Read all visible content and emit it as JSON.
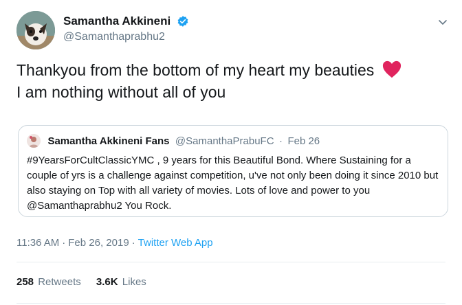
{
  "tweet": {
    "author": {
      "display_name": "Samantha Akkineni",
      "handle": "@Samanthaprabhu2",
      "verified": true,
      "avatar_icon": "dog-avatar-icon"
    },
    "menu_icon": "chevron-down-icon",
    "text": "Thankyou from the bottom of my heart my beauties",
    "text_line2": "I am nothing without all of you",
    "emoji_icon": "red-heart-icon",
    "quoted": {
      "display_name": "Samantha Akkineni Fans",
      "handle": "@SamanthaPrabuFC",
      "separator": "·",
      "date": "Feb 26",
      "text": "#9YearsForCultClassicYMC , 9 years for this Beautiful Bond. Where Sustaining for a couple of yrs is a challenge against competition, u've not only been doing it since 2010 but also staying on Top with all variety of movies. Lots of love and power to you @Samanthaprabhu2 You Rock."
    },
    "meta": {
      "time": "11:36 AM",
      "separator": "·",
      "date": "Feb 26, 2019",
      "separator2": "·",
      "source": "Twitter Web App"
    },
    "stats": {
      "retweets_count": "258",
      "retweets_label": "Retweets",
      "likes_count": "3.6K",
      "likes_label": "Likes"
    },
    "colors": {
      "link": "#1da1f2",
      "secondary_text": "#657786",
      "primary_text": "#14171a",
      "border": "#ccd6dd",
      "heart": "#e0245e"
    }
  }
}
